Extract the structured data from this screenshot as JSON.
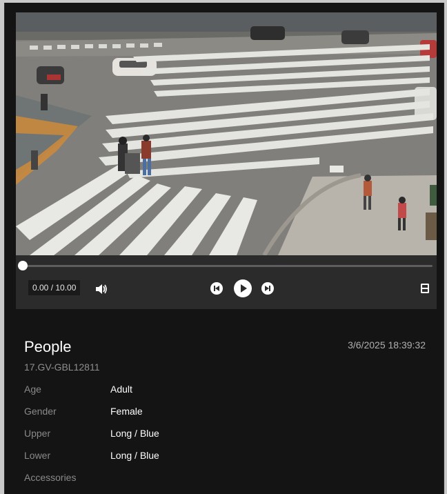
{
  "player": {
    "time_display": "0.00 / 10.00",
    "progress_fraction": 0.0
  },
  "event": {
    "title": "People",
    "timestamp": "3/6/2025 18:39:32",
    "device": "17.GV-GBL12811"
  },
  "attributes": [
    {
      "key": "Age",
      "value": "Adult"
    },
    {
      "key": "Gender",
      "value": "Female"
    },
    {
      "key": "Upper",
      "value": "Long / Blue"
    },
    {
      "key": "Lower",
      "value": "Long / Blue"
    },
    {
      "key": "Accessories",
      "value": ""
    }
  ],
  "icons": {
    "volume": "volume-icon",
    "prev": "skip-back-icon",
    "play": "play-icon",
    "next": "skip-forward-icon",
    "filmstrip": "filmstrip-icon"
  }
}
